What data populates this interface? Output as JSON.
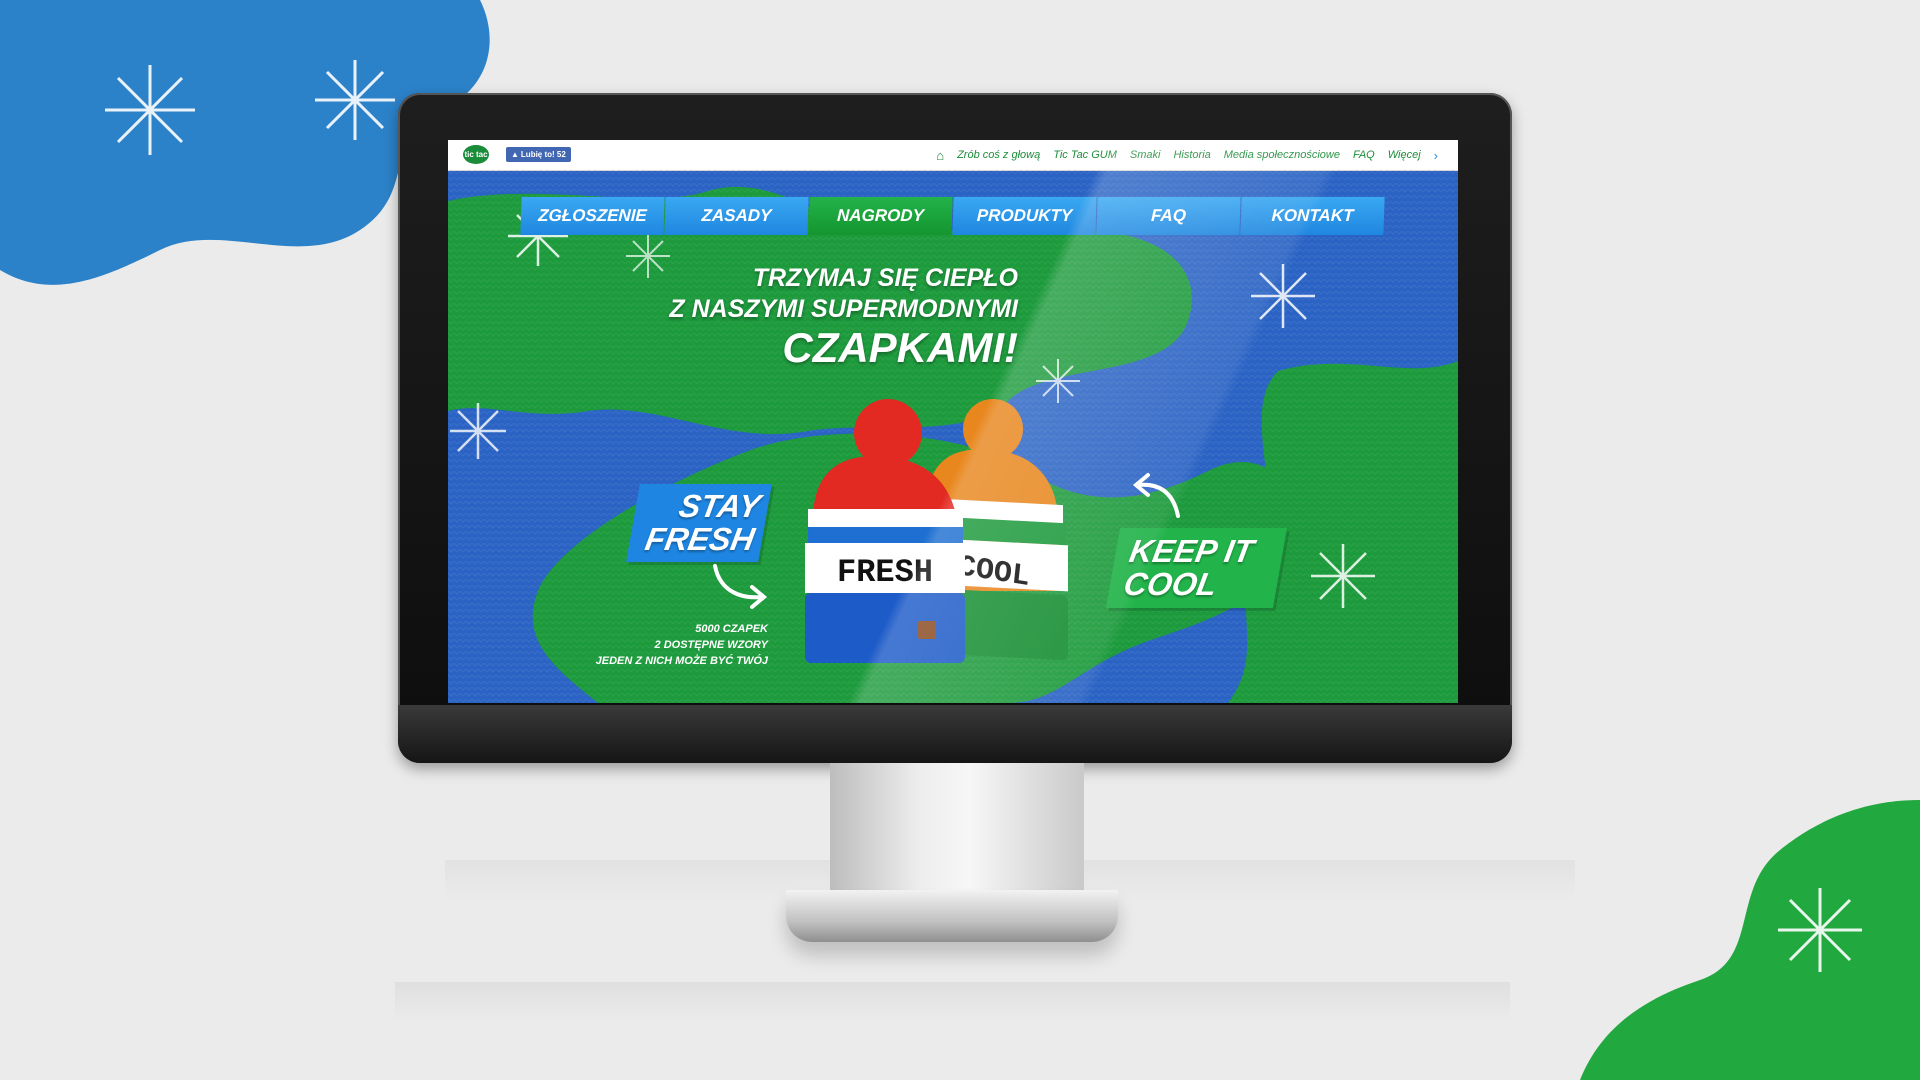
{
  "site": {
    "logo_text": "tic tac",
    "like_button": "Lubię to! 52",
    "top_links": [
      "Zrób coś z głową",
      "Tic Tac GUM",
      "Smaki",
      "Historia",
      "Media społecznościowe",
      "FAQ",
      "Więcej"
    ]
  },
  "nav": {
    "items": [
      "ZGŁOSZENIE",
      "ZASADY",
      "NAGRODY",
      "PRODUKTY",
      "FAQ",
      "KONTAKT"
    ],
    "active": "NAGRODY"
  },
  "hero": {
    "headline_1": "TRZYMAJ SIĘ CIEPŁO",
    "headline_2": "Z NASZYMI SUPERMODNYMI",
    "headline_3": "CZAPKAMI!",
    "stay_1": "STAY",
    "stay_2": "FRESH",
    "keep_1": "KEEP IT",
    "keep_2": "COOL",
    "hat_fresh_text": "FRESH",
    "hat_cool_text": "COOL",
    "promo_1": "5000 CZAPEK",
    "promo_2": "2 DOSTĘPNE WZORY",
    "promo_3": "JEDEN Z NICH MOŻE BYĆ TWÓJ"
  },
  "colors": {
    "blue": "#2a63c4",
    "green": "#1c9a3c",
    "nav_blue": "#1f87e0",
    "nav_active_green": "#15952f",
    "facebook_blue": "#4267b2"
  },
  "icons": [
    "home-icon",
    "thumbs-up-icon",
    "chevron-right-icon",
    "snowflake-icon",
    "curved-arrow-icon"
  ]
}
